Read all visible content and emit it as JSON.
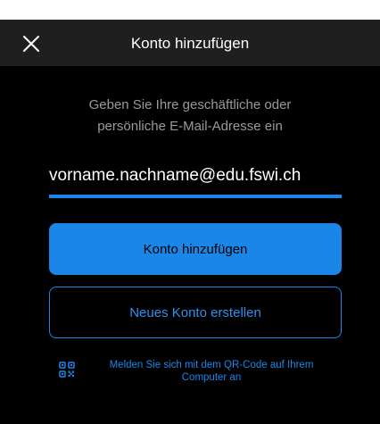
{
  "header": {
    "title": "Konto hinzufügen",
    "close_icon": "close-icon"
  },
  "instruction": {
    "line1": "Geben Sie Ihre geschäftliche oder",
    "line2": "persönliche E-Mail-Adresse ein"
  },
  "email": {
    "value": "vorname.nachname@edu.fswi.ch"
  },
  "buttons": {
    "add_account": "Konto hinzufügen",
    "create_account": "Neues Konto erstellen"
  },
  "qr": {
    "icon": "qr-code-icon",
    "line1": "Melden Sie sich mit dem QR-Code auf Ihrem",
    "line2": "Computer an"
  },
  "colors": {
    "accent": "#1a86e8",
    "background": "#000000",
    "header": "#1f1f1f",
    "muted_text": "#9a9a9a"
  }
}
